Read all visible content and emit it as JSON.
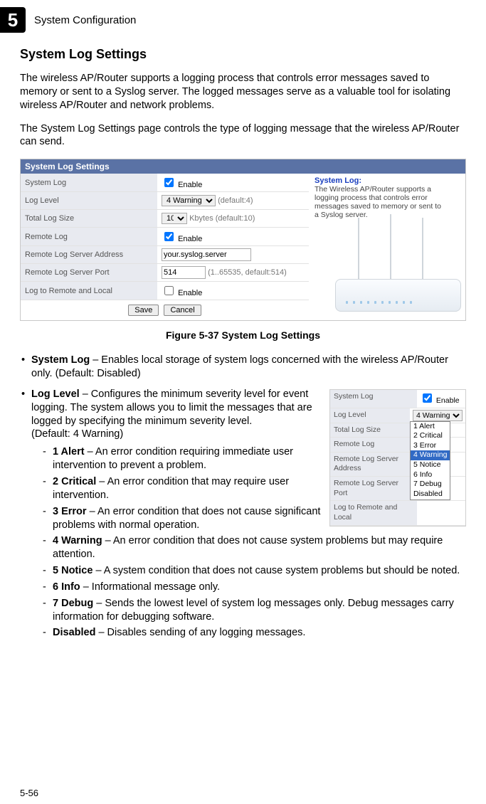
{
  "header": {
    "chapter_number": "5",
    "chapter_title": "System Configuration"
  },
  "section_title": "System Log Settings",
  "intro_p1": "The wireless AP/Router supports a logging process that controls error messages saved to memory or sent to a Syslog server. The logged messages serve as a valuable tool for isolating wireless AP/Router and network problems.",
  "intro_p2": "The System Log Settings page controls the type of logging message that the wireless AP/Router can send.",
  "panel": {
    "title": "System Log Settings",
    "rows": {
      "system_log": {
        "label": "System Log",
        "enable_label": "Enable",
        "checked": true
      },
      "log_level": {
        "label": "Log Level",
        "value": "4 Warning",
        "suffix": "(default:4)"
      },
      "total_log_size": {
        "label": "Total Log Size",
        "value": "10",
        "suffix": "Kbytes (default:10)"
      },
      "remote_log": {
        "label": "Remote Log",
        "enable_label": "Enable",
        "checked": true
      },
      "remote_addr": {
        "label": "Remote Log Server Address",
        "value": "your.syslog.server"
      },
      "remote_port": {
        "label": "Remote Log Server Port",
        "value": "514",
        "suffix": "(1..65535, default:514)"
      },
      "log_both": {
        "label": "Log to Remote and Local",
        "enable_label": "Enable",
        "checked": false
      }
    },
    "help": {
      "title": "System Log:",
      "text": "The Wireless AP/Router supports a logging process that controls error messages saved to memory or sent to a Syslog server."
    },
    "buttons": {
      "save": "Save",
      "cancel": "Cancel"
    }
  },
  "figure_caption": "Figure 5-37  System Log Settings",
  "bullets": {
    "system_log": {
      "term": "System Log",
      "desc": " – Enables local storage of system logs concerned with the wireless AP/Router only. (Default: Disabled)"
    },
    "log_level": {
      "term": "Log Level",
      "desc": " – Configures the minimum severity level for event logging. The system allows you to limit the messages that are logged by specifying the minimum severity level.",
      "default_line": "(Default: 4 Warning)",
      "options": [
        {
          "term": "1 Alert",
          "desc": " – An error condition requiring immediate user intervention to prevent a problem."
        },
        {
          "term": "2 Critical",
          "desc": " – An error condition that may require user intervention."
        },
        {
          "term": "3 Error",
          "desc": " – An error condition that does not cause significant problems with normal operation."
        },
        {
          "term": "4 Warning",
          "desc": " – An error condition that does not cause system problems but may require attention."
        },
        {
          "term": "5 Notice",
          "desc": " – A system condition that does not cause system problems but should be noted."
        },
        {
          "term": "6 Info",
          "desc": " – Informational message only."
        },
        {
          "term": "7 Debug",
          "desc": " – Sends the lowest level of system log messages only. Debug messages carry information for debugging software."
        },
        {
          "term": "Disabled",
          "desc": " – Disables sending of any logging messages."
        }
      ]
    }
  },
  "inline_panel": {
    "rows": [
      {
        "label": "System Log",
        "enable": true,
        "enable_label": "Enable"
      },
      {
        "label": "Log Level",
        "select": "4 Warning"
      },
      {
        "label": "Total Log Size"
      },
      {
        "label": "Remote Log"
      },
      {
        "label": "Remote Log Server Address"
      },
      {
        "label": "Remote Log Server Port"
      },
      {
        "label": "Log to Remote and Local"
      }
    ],
    "dropdown_options": [
      "1 Alert",
      "2 Critical",
      "3 Error",
      "4 Warning",
      "5 Notice",
      "6 Info",
      "7 Debug",
      "Disabled"
    ],
    "dropdown_selected_index": 3
  },
  "page_number": "5-56"
}
